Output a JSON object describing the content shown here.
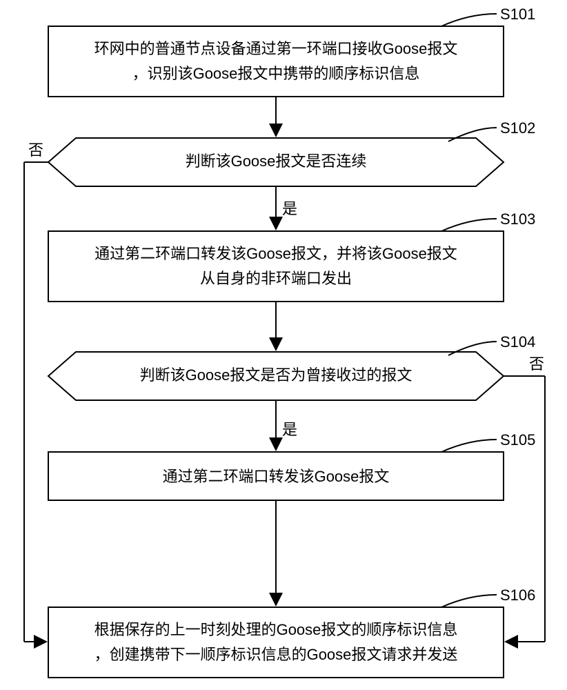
{
  "steps": {
    "s101": {
      "id": "S101",
      "line1": "环网中的普通节点设备通过第一环端口接收Goose报文",
      "line2": "，识别该Goose报文中携带的顺序标识信息"
    },
    "s102": {
      "id": "S102",
      "text": "判断该Goose报文是否连续"
    },
    "s103": {
      "id": "S103",
      "line1": "通过第二环端口转发该Goose报文，并将该Goose报文",
      "line2": "从自身的非环端口发出"
    },
    "s104": {
      "id": "S104",
      "text": "判断该Goose报文是否为曾接收过的报文"
    },
    "s105": {
      "id": "S105",
      "text": "通过第二环端口转发该Goose报文"
    },
    "s106": {
      "id": "S106",
      "line1": "根据保存的上一时刻处理的Goose报文的顺序标识信息",
      "line2": "，创建携带下一顺序标识信息的Goose报文请求并发送"
    }
  },
  "branches": {
    "no": "否",
    "yes": "是"
  }
}
